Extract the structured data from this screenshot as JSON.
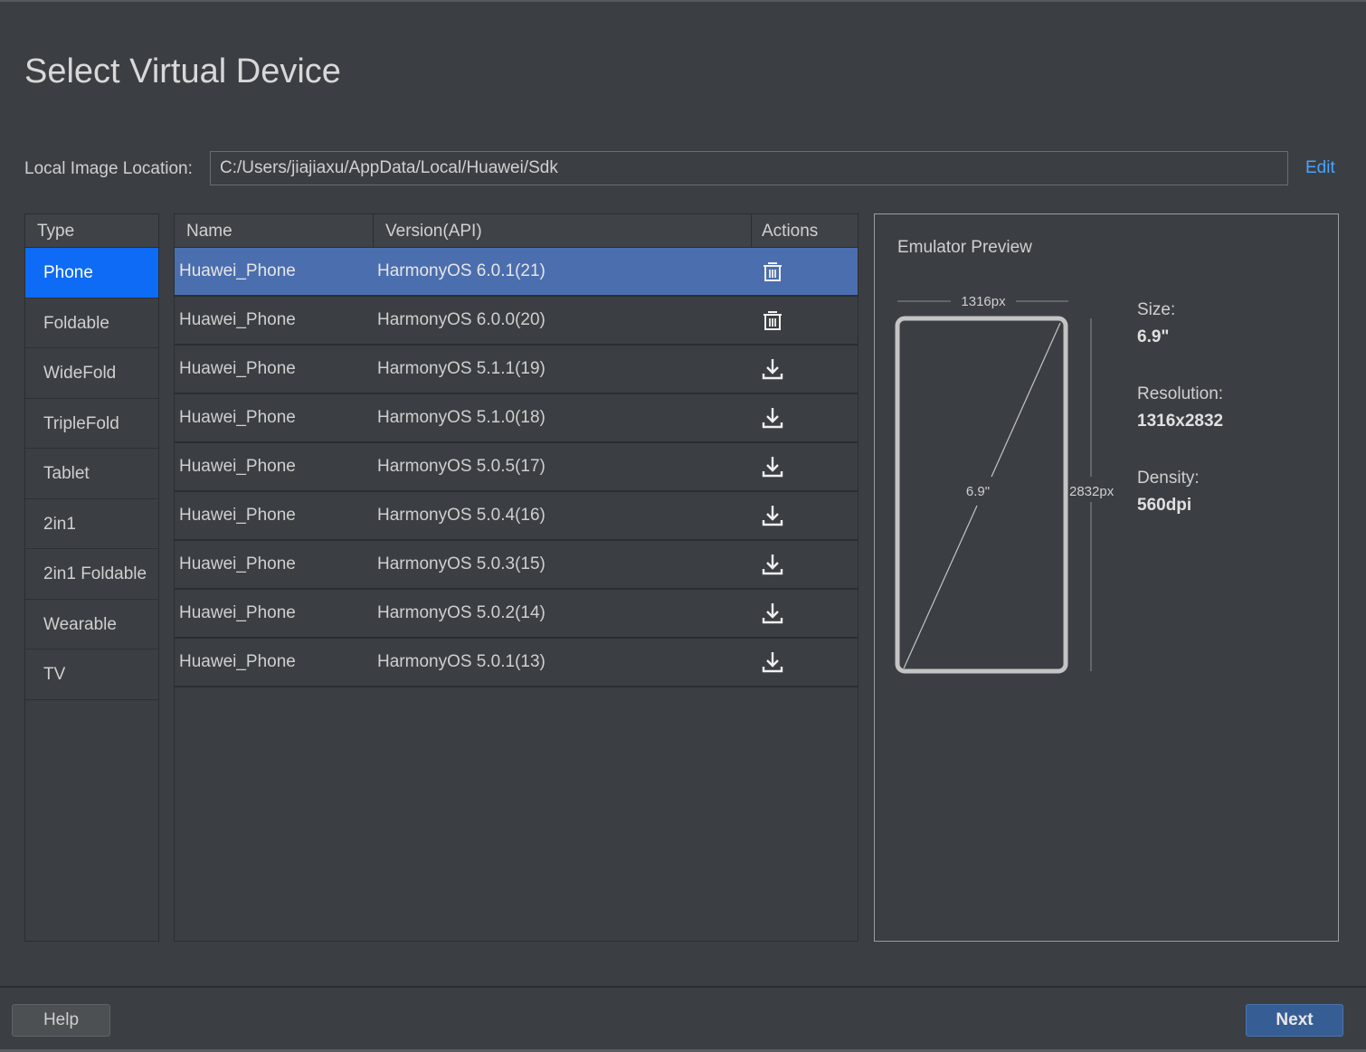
{
  "title": "Select Virtual Device",
  "location": {
    "label": "Local Image Location:",
    "value": "C:/Users/jiajiaxu/AppData/Local/Huawei/Sdk",
    "edit_label": "Edit"
  },
  "types": {
    "header": "Type",
    "items": [
      "Phone",
      "Foldable",
      "WideFold",
      "TripleFold",
      "Tablet",
      "2in1",
      "2in1 Foldable",
      "Wearable",
      "TV"
    ],
    "selected": "Phone"
  },
  "devices": {
    "columns": [
      "Name",
      "Version(API)",
      "Actions"
    ],
    "rows": [
      {
        "name": "Huawei_Phone",
        "version": "HarmonyOS 6.0.1(21)",
        "action": "delete-icon"
      },
      {
        "name": "Huawei_Phone",
        "version": "HarmonyOS 6.0.0(20)",
        "action": "delete-icon"
      },
      {
        "name": "Huawei_Phone",
        "version": "HarmonyOS 5.1.1(19)",
        "action": "download-icon"
      },
      {
        "name": "Huawei_Phone",
        "version": "HarmonyOS 5.1.0(18)",
        "action": "download-icon"
      },
      {
        "name": "Huawei_Phone",
        "version": "HarmonyOS 5.0.5(17)",
        "action": "download-icon"
      },
      {
        "name": "Huawei_Phone",
        "version": "HarmonyOS 5.0.4(16)",
        "action": "download-icon"
      },
      {
        "name": "Huawei_Phone",
        "version": "HarmonyOS 5.0.3(15)",
        "action": "download-icon"
      },
      {
        "name": "Huawei_Phone",
        "version": "HarmonyOS 5.0.2(14)",
        "action": "download-icon"
      },
      {
        "name": "Huawei_Phone",
        "version": "HarmonyOS 5.0.1(13)",
        "action": "download-icon"
      }
    ],
    "selected_index": 0
  },
  "preview": {
    "title": "Emulator Preview",
    "width_label": "1316px",
    "height_label": "2832px",
    "diagonal_label": "6.9\"",
    "size_label": "Size:",
    "size_value": "6.9\"",
    "resolution_label": "Resolution:",
    "resolution_value": "1316x2832",
    "density_label": "Density:",
    "density_value": "560dpi"
  },
  "buttons": {
    "help": "Help",
    "next": "Next"
  },
  "colors": {
    "background": "#3b3f43",
    "selection_blue": "#0d6bf5",
    "row_selected": "#4b6eaf",
    "link": "#4aa3ff",
    "next_button": "#375e94"
  }
}
